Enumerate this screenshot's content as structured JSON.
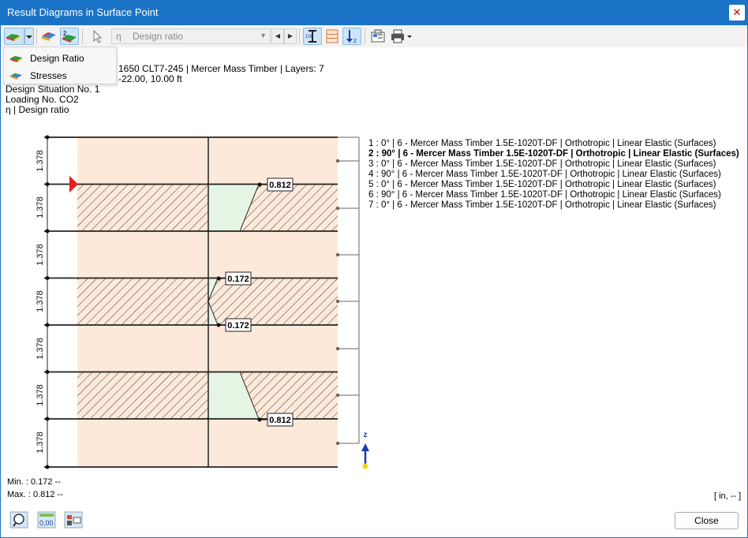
{
  "window": {
    "title": "Result Diagrams in Surface Point",
    "close_glyph": "✕"
  },
  "toolbar": {
    "combo_symbol": "η",
    "combo_value": "Design ratio",
    "icons": [
      "result-type-icon",
      "dropdown-arrow-icon",
      "surface-results-icon",
      "ratio-display-icon",
      "select-pointer-icon",
      "nav-prev-icon",
      "nav-next-icon",
      "section-values-icon",
      "layers-icon",
      "z-axis-icon",
      "export-icon",
      "print-icon"
    ]
  },
  "menu": {
    "items": [
      "Design Ratio",
      "Stresses"
    ]
  },
  "info": {
    "line1": "1650 CLT7-245 | Mercer Mass Timber | Layers: 7",
    "line2": "-22.00, 10.00 ft",
    "line3": "Design Situation No. 1",
    "line4": "Loading No. CO2",
    "line5": "η | Design ratio"
  },
  "diagram": {
    "layer_thickness_labels": [
      "1.378",
      "1.378",
      "1.378",
      "1.378",
      "1.378",
      "1.378",
      "1.378"
    ],
    "value_labels": [
      "0.812",
      "0.172",
      "0.172",
      "0.812"
    ],
    "axis_label": "z",
    "colors": {
      "layer_fill": "#fde9d9",
      "ratio_fill": "#e6f4e4",
      "marker": "#e8201c",
      "axis": "#1a3fa8"
    }
  },
  "legend": {
    "lines": [
      "1 :     0° | 6 - Mercer Mass Timber 1.5E-1020T-DF | Orthotropic | Linear Elastic (Surfaces)",
      "2 :   90° | 6 - Mercer Mass Timber 1.5E-1020T-DF | Orthotropic | Linear Elastic (Surfaces)",
      "3 :     0° | 6 - Mercer Mass Timber 1.5E-1020T-DF | Orthotropic | Linear Elastic (Surfaces)",
      "4 :   90° | 6 - Mercer Mass Timber 1.5E-1020T-DF | Orthotropic | Linear Elastic (Surfaces)",
      "5 :     0° | 6 - Mercer Mass Timber 1.5E-1020T-DF | Orthotropic | Linear Elastic (Surfaces)",
      "6 :   90° | 6 - Mercer Mass Timber 1.5E-1020T-DF | Orthotropic | Linear Elastic (Surfaces)",
      "7 :     0° | 6 - Mercer Mass Timber 1.5E-1020T-DF | Orthotropic | Linear Elastic (Surfaces)"
    ],
    "bold_index": 1
  },
  "summary": {
    "min": "Min. : 0.172 --",
    "max": "Max. : 0.812 --",
    "units": "[ in, -- ]"
  },
  "bottom_icons": [
    "help-icon",
    "decimal-places-icon",
    "settings-icon"
  ],
  "buttons": {
    "close": "Close"
  }
}
